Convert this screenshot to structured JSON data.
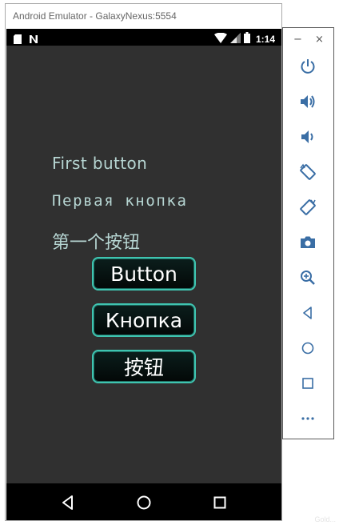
{
  "window": {
    "title": "Android Emulator - GalaxyNexus:5554"
  },
  "status_bar": {
    "time": "1:14",
    "left_icons": [
      "sd-card-icon",
      "n-notification-icon"
    ],
    "right_icons": [
      "wifi-icon",
      "signal-icon",
      "battery-icon"
    ]
  },
  "app": {
    "labels": [
      "First button",
      "Первая кнопка",
      "第一个按钮"
    ],
    "buttons": [
      "Button",
      "Кнопка",
      "按钮"
    ],
    "accent_color": "#3fc4b0",
    "label_color": "#b6d5d2",
    "background_color": "#303030"
  },
  "nav_bar": {
    "buttons": [
      "back-icon",
      "home-icon",
      "recents-icon"
    ]
  },
  "toolbar": {
    "window_controls": [
      "minimize-icon",
      "close-icon"
    ],
    "items": [
      "power-icon",
      "volume-up-icon",
      "volume-down-icon",
      "rotate-left-icon",
      "rotate-right-icon",
      "camera-icon",
      "zoom-icon",
      "back-icon",
      "home-icon",
      "overview-icon",
      "more-icon"
    ],
    "minimize_glyph": "−",
    "close_glyph": "×"
  },
  "watermark": "Gold..."
}
